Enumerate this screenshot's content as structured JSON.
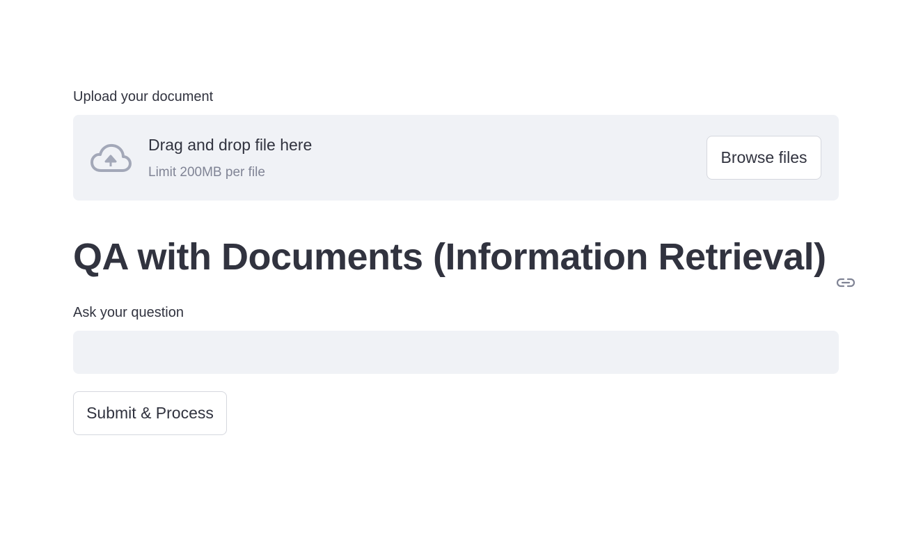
{
  "uploader": {
    "label": "Upload your document",
    "drop_text": "Drag and drop file here",
    "limit_text": "Limit 200MB per file",
    "browse_label": "Browse files",
    "icon": "cloud-upload-icon"
  },
  "page": {
    "title": "QA with Documents (Information Retrieval)",
    "anchor_icon": "link-icon"
  },
  "question": {
    "label": "Ask your question",
    "value": "",
    "placeholder": ""
  },
  "actions": {
    "submit_label": "Submit & Process"
  },
  "colors": {
    "text": "#31333f",
    "muted": "#808495",
    "input_bg": "#f0f2f6",
    "icon": "#a3a8b8",
    "border": "#d5d7de"
  }
}
